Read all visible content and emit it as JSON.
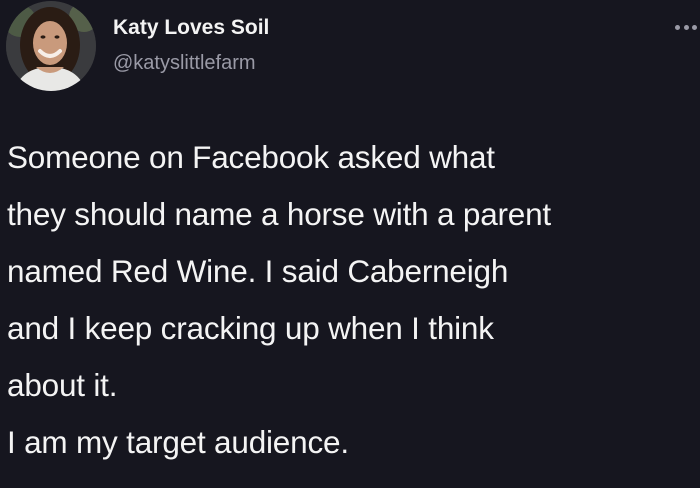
{
  "author": {
    "display_name": "Katy Loves Soil",
    "handle": "@katyslittlefarm",
    "avatar": "profile-photo"
  },
  "tweet": {
    "lines": [
      "Someone on Facebook asked what",
      "they should name a horse with a parent",
      "named Red Wine. I said Caberneigh",
      "and I keep cracking up when I think",
      "about it.",
      "I am my target audience."
    ]
  },
  "icons": {
    "more": "more-options-icon"
  },
  "colors": {
    "background": "#16161f",
    "text": "#f4f4f4",
    "secondary_text": "#9a9aa6"
  }
}
